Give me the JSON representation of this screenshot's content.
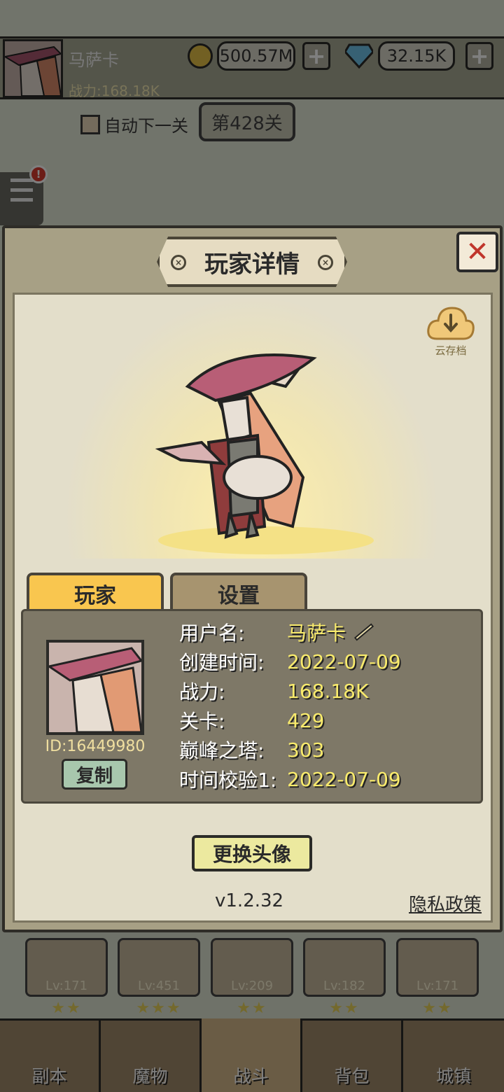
{
  "header": {
    "player_name": "马萨卡",
    "power_text": "战力:168.18K",
    "gold": "500.57M",
    "gems": "32.15K",
    "plus_label": "+",
    "auto_next_label": "自动下一关",
    "stage_label": "第428关",
    "alert_badge": "!"
  },
  "dialog": {
    "title": "玩家详情",
    "close_label": "✕",
    "cloud_save_label": "云存档",
    "tabs": [
      {
        "label": "玩家",
        "active": true
      },
      {
        "label": "设置",
        "active": false
      }
    ],
    "player_id": "ID:16449980",
    "copy_label": "复制",
    "info": [
      {
        "key": "用户名:",
        "value": "马萨卡"
      },
      {
        "key": "创建时间:",
        "value": "2022-07-09"
      },
      {
        "key": "战力:",
        "value": "168.18K"
      },
      {
        "key": "关卡:",
        "value": "429"
      },
      {
        "key": "巅峰之塔:",
        "value": "303"
      },
      {
        "key": "时间校验1:",
        "value": "2022-07-09"
      }
    ],
    "change_avatar_label": "更换头像",
    "version": "v1.2.32",
    "privacy_label": "隐私政策"
  },
  "heroes": [
    {
      "level": "Lv:171",
      "stars": "★★"
    },
    {
      "level": "Lv:451",
      "stars": "★★★"
    },
    {
      "level": "Lv:209",
      "stars": "★★"
    },
    {
      "level": "Lv:182",
      "stars": "★★"
    },
    {
      "level": "Lv:171",
      "stars": "★★"
    }
  ],
  "nav": [
    {
      "label": "副本",
      "active": false
    },
    {
      "label": "魔物",
      "active": false
    },
    {
      "label": "战斗",
      "active": true
    },
    {
      "label": "背包",
      "active": false
    },
    {
      "label": "城镇",
      "active": false
    }
  ],
  "colors": {
    "tab_active": "#f9c64f",
    "value_text": "#f9eb6c",
    "close_x": "#c0352b"
  }
}
